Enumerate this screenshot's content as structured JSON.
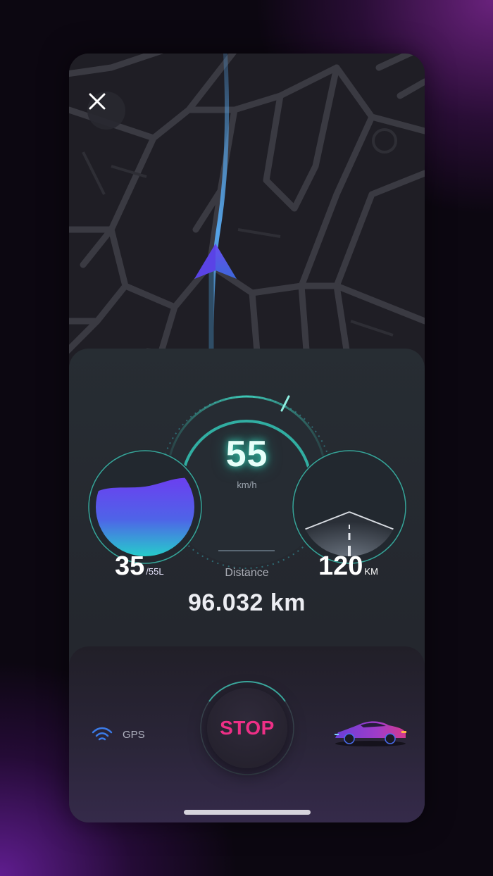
{
  "map": {
    "close_icon": "close-icon",
    "nav_icon": "navigation-arrow-icon"
  },
  "speedometer": {
    "speed": "55",
    "unit": "km/h"
  },
  "fuel": {
    "value": "35",
    "capacity": "/55L",
    "level_fraction": 0.636
  },
  "range": {
    "value": "120",
    "unit": "KM"
  },
  "distance": {
    "label": "Distance",
    "value": "96.032 km"
  },
  "controls": {
    "gps_label": "GPS",
    "gps_icon": "wifi-signal-icon",
    "stop_label": "STOP",
    "car_icon": "sports-car-icon"
  },
  "colors": {
    "accent_teal": "#3fd9c4",
    "stop_pink": "#ee2f86",
    "fuel_purple": "#6b3ff0",
    "route_blue": "#56a4e8"
  }
}
